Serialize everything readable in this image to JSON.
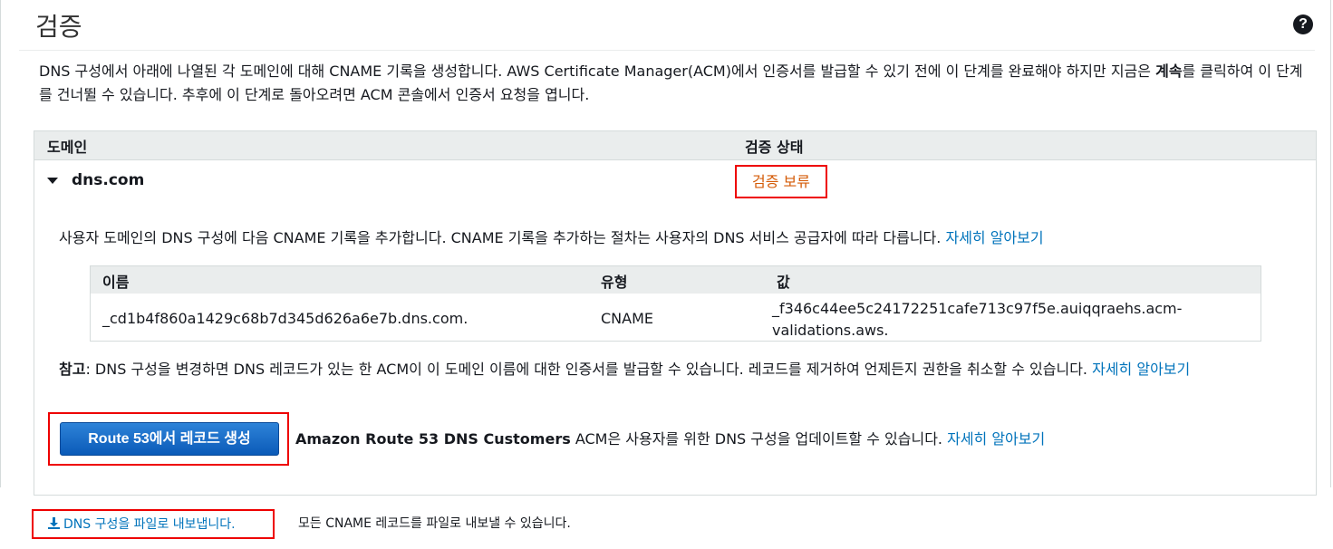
{
  "header": {
    "title": "검증",
    "help_icon": "?"
  },
  "intro": {
    "text": "DNS 구성에서 아래에 나열된 각 도메인에 대해 CNAME 기록을 생성합니다. AWS Certificate Manager(ACM)에서 인증서를 발급할 수 있기 전에 이 단계를 완료해야 하지만 지금은 ",
    "bold": "계속",
    "text_after": "를 클릭하여 이 단계를 건너뛸 수 있습니다. 추후에 이 단계로 돌아오려면 ACM 콘솔에서 인증서 요청을 엽니다."
  },
  "table": {
    "col_domain": "도메인",
    "col_status": "검증 상태"
  },
  "domain_row": {
    "name": "dns.com",
    "status": "검증 보류",
    "status_color": "#d45b07",
    "instruction": "사용자 도메인의 DNS 구성에 다음 CNAME 기록을 추가합니다. CNAME 기록을 추가하는 절차는 사용자의 DNS 서비스 공급자에 따라 다릅니다.",
    "instruction_link": "자세히 알아보기"
  },
  "cname": {
    "col_name": "이름",
    "col_type": "유형",
    "col_value": "값",
    "name": "_cd1b4f860a1429c68b7d345d626a6e7b.dns.com.",
    "type": "CNAME",
    "value": "_f346c44ee5c24172251cafe713c97f5e.auiqqraehs.acm-validations.aws."
  },
  "note": {
    "label": "참고",
    "text": ": DNS 구성을 변경하면 DNS 레코드가 있는 한 ACM이 이 도메인 이름에 대한 인증서를 발급할 수 있습니다. 레코드를 제거하여 언제든지 권한을 취소할 수 있습니다.",
    "link": "자세히 알아보기"
  },
  "route53": {
    "button_label": "Route 53에서 레코드 생성",
    "bold_text": "Amazon Route 53 DNS Customers",
    "text": " ACM은 사용자를 위한 DNS 구성을 업데이트할 수 있습니다.",
    "link": "자세히 알아보기"
  },
  "export": {
    "icon": "download-icon",
    "link_label": "DNS 구성을 파일로 내보냅니다.",
    "description": "모든 CNAME 레코드를 파일로 내보낼 수 있습니다."
  },
  "colors": {
    "accent_link": "#0073bb",
    "button_blue": "#1466c4",
    "highlight_red": "#e00000"
  }
}
